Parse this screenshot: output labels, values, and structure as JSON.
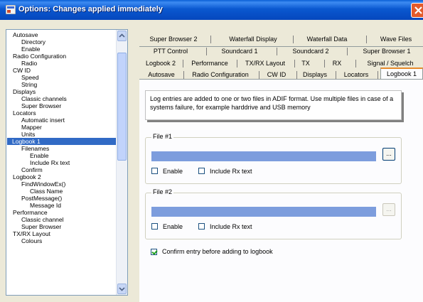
{
  "window": {
    "title": "Options: Changes applied immediately"
  },
  "tree": {
    "items": [
      {
        "label": "Autosave"
      },
      {
        "label": "Directory"
      },
      {
        "label": "Enable"
      },
      {
        "label": "Radio Configuration"
      },
      {
        "label": "Radio"
      },
      {
        "label": "CW ID"
      },
      {
        "label": "Speed"
      },
      {
        "label": "String"
      },
      {
        "label": "Displays"
      },
      {
        "label": "Classic channels"
      },
      {
        "label": "Super Browser"
      },
      {
        "label": "Locators"
      },
      {
        "label": "Automatic insert"
      },
      {
        "label": "Mapper"
      },
      {
        "label": "Units"
      },
      {
        "label": "Logbook 1"
      },
      {
        "label": "Filenames"
      },
      {
        "label": "Enable"
      },
      {
        "label": "Include Rx text"
      },
      {
        "label": "Confirm"
      },
      {
        "label": "Logbook 2"
      },
      {
        "label": "FindWindowEx()"
      },
      {
        "label": "Class Name"
      },
      {
        "label": "PostMessage()"
      },
      {
        "label": "Message Id"
      },
      {
        "label": "Performance"
      },
      {
        "label": "Classic channel"
      },
      {
        "label": "Super Browser"
      },
      {
        "label": "TX/RX Layout"
      },
      {
        "label": "Colours"
      }
    ],
    "selected_label": "Logbook 1"
  },
  "tabs": {
    "row1": [
      "Super Browser 2",
      "Waterfall Display",
      "Waterfall Data",
      "Wave Files"
    ],
    "row2": [
      "PTT Control",
      "Soundcard 1",
      "Soundcard 2",
      "Super Browser 1"
    ],
    "row3": [
      "Logbook 2",
      "Performance",
      "TX/RX Layout",
      "TX",
      "RX",
      "Signal / Squelch"
    ],
    "row4": [
      "Autosave",
      "Radio Configuration",
      "CW ID",
      "Displays",
      "Locators",
      "Logbook 1"
    ],
    "active": "Logbook 1"
  },
  "logbook": {
    "info_text": "Log entries are added to one or two files in ADIF format. Use multiple files in case of a systems failure, for example harddrive and  USB memory",
    "file1": {
      "legend": "File #1",
      "browse_label": "...",
      "enable_label": "Enable",
      "include_rx_label": "Include Rx text",
      "enable_checked": false,
      "include_rx_checked": false
    },
    "file2": {
      "legend": "File #2",
      "browse_label": "...",
      "enable_label": "Enable",
      "include_rx_label": "Include Rx text",
      "enable_checked": false,
      "include_rx_checked": false
    },
    "confirm_label": "Confirm entry before adding to logbook",
    "confirm_checked": true
  },
  "colors": {
    "selection": "#316ac5",
    "file_path_bar": "#7d9ddd",
    "title_bar": "#0a58d0"
  }
}
